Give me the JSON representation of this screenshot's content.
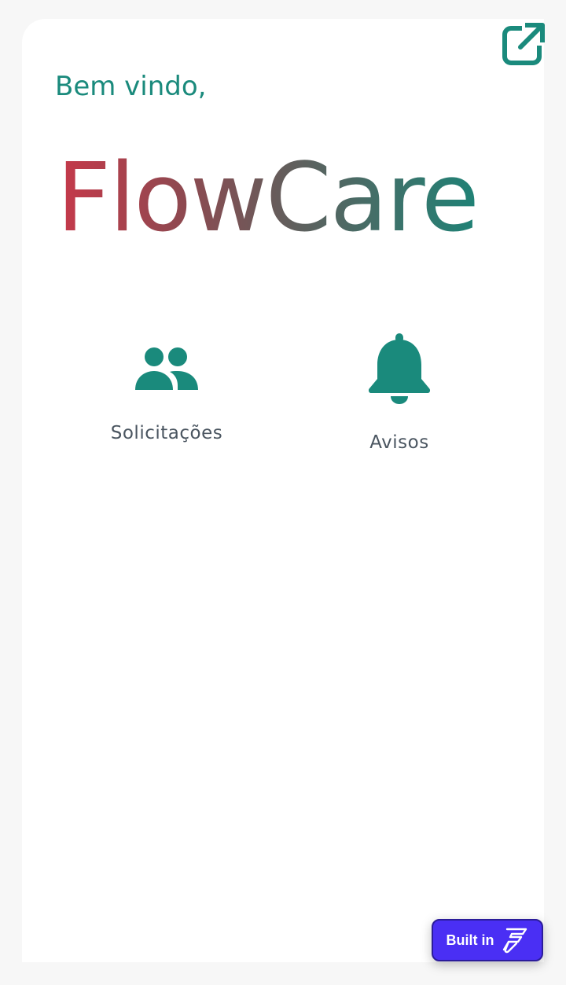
{
  "header": {
    "greeting": "Bem vindo,",
    "app_name": "FlowCare",
    "open_icon": "open-in-new-icon"
  },
  "menu": {
    "items": [
      {
        "label": "Solicitações",
        "icon": "people-icon"
      },
      {
        "label": "Avisos",
        "icon": "bell-icon"
      }
    ]
  },
  "badge": {
    "label": "Built in",
    "icon": "flutterflow-logo-icon"
  },
  "colors": {
    "accent": "#1a8a7c",
    "brand_gradient": [
      "#c6394a",
      "#625e5c",
      "#1f8276"
    ],
    "badge_bg": "#4a2ff4",
    "label_text": "#4a5560"
  }
}
